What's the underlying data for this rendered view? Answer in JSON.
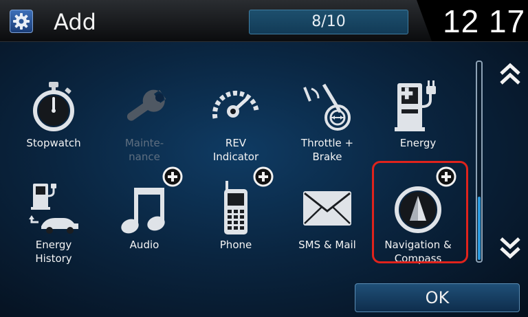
{
  "header": {
    "title": "Add",
    "page_indicator": "8/10",
    "clock": "12 17"
  },
  "apps": [
    {
      "label": "Stopwatch",
      "icon": "stopwatch-icon",
      "enabled": true,
      "addable": false
    },
    {
      "label": "Mainte-\nnance",
      "icon": "wrench-icon",
      "enabled": false,
      "addable": false
    },
    {
      "label": "REV\nIndicator",
      "icon": "gauge-icon",
      "enabled": true,
      "addable": false
    },
    {
      "label": "Throttle +\nBrake",
      "icon": "throttle-brake-icon",
      "enabled": true,
      "addable": false
    },
    {
      "label": "Energy",
      "icon": "fuel-plug-icon",
      "enabled": true,
      "addable": false
    },
    {
      "label": "Energy\nHistory",
      "icon": "energy-history-icon",
      "enabled": true,
      "addable": false
    },
    {
      "label": "Audio",
      "icon": "music-note-icon",
      "enabled": true,
      "addable": true
    },
    {
      "label": "Phone",
      "icon": "phone-icon",
      "enabled": true,
      "addable": true
    },
    {
      "label": "SMS & Mail",
      "icon": "envelope-icon",
      "enabled": true,
      "addable": false
    },
    {
      "label": "Navigation &\nCompass",
      "icon": "compass-icon",
      "enabled": true,
      "addable": true,
      "selected": true
    }
  ],
  "scroll": {
    "up_icon": "double-chevron-up-icon",
    "down_icon": "double-chevron-down-icon"
  },
  "footer": {
    "ok_label": "OK"
  },
  "colors": {
    "highlight": "#e0231c",
    "accent": "#2a9be0",
    "background": "#0a2540"
  }
}
